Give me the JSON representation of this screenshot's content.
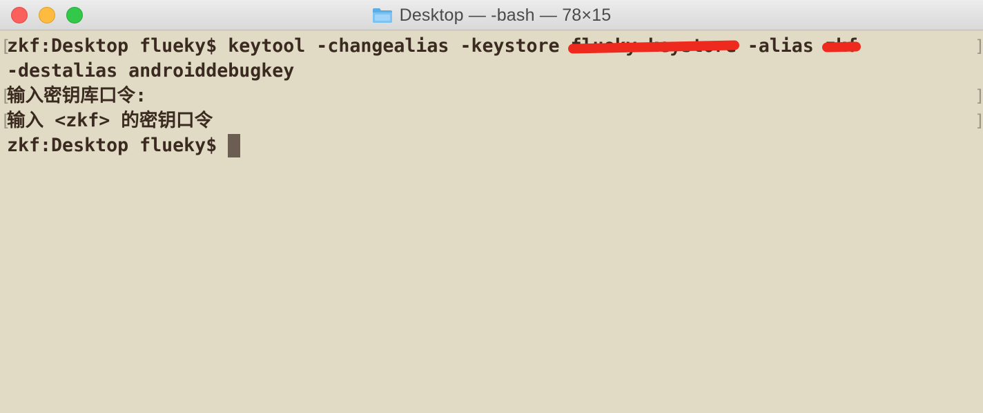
{
  "window": {
    "title": "Desktop — -bash — 78×15",
    "title_icon": "folder-icon",
    "buttons": {
      "close": "close-button",
      "minimize": "minimize-button",
      "zoom": "zoom-button"
    }
  },
  "colors": {
    "terminal_background": "#e1dbc5",
    "terminal_text": "#3a2a20",
    "cursor": "#6b5d52",
    "redaction": "#ee2a1e"
  },
  "terminal": {
    "line1": {
      "prompt": "zkf:Desktop flueky$ ",
      "command": "keytool -changealias -keystore ",
      "keystore_arg": "flueky.keystore",
      "alias_flag": " -alias ",
      "alias_arg": "zkf"
    },
    "line2": "-destalias androiddebugkey",
    "line3": "输入密钥库口令:",
    "line4": "输入 <zkf> 的密钥口令",
    "line5": {
      "prompt": "zkf:Desktop flueky$ "
    },
    "bracket_left": "[",
    "bracket_right": "]"
  }
}
